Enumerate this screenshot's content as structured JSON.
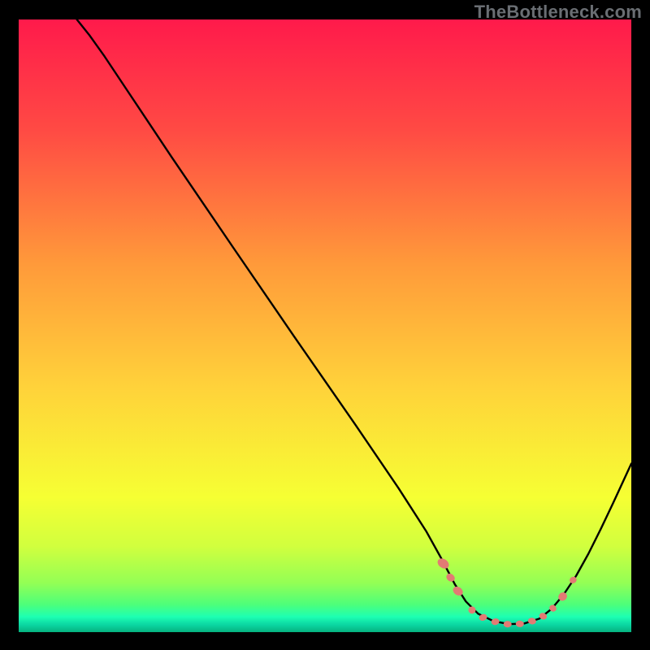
{
  "watermark": "TheBottleneck.com",
  "chart_data": {
    "type": "line",
    "title": "",
    "xlabel": "",
    "ylabel": "",
    "xlim": [
      0,
      100
    ],
    "ylim": [
      0,
      100
    ],
    "grid": false,
    "legend": false,
    "annotations": [],
    "background_gradient_stops": [
      {
        "offset": 0.0,
        "color": "#ff1a4b"
      },
      {
        "offset": 0.18,
        "color": "#ff4a44"
      },
      {
        "offset": 0.4,
        "color": "#ff9a3a"
      },
      {
        "offset": 0.6,
        "color": "#ffd23a"
      },
      {
        "offset": 0.78,
        "color": "#f6ff33"
      },
      {
        "offset": 0.86,
        "color": "#d1ff3e"
      },
      {
        "offset": 0.92,
        "color": "#93ff55"
      },
      {
        "offset": 0.955,
        "color": "#4dff7a"
      },
      {
        "offset": 0.975,
        "color": "#1dffb2"
      },
      {
        "offset": 0.988,
        "color": "#0bd6a2"
      },
      {
        "offset": 1.0,
        "color": "#06b27f"
      }
    ],
    "curve": [
      {
        "x": 9.5,
        "y": 100.0
      },
      {
        "x": 11.5,
        "y": 97.5
      },
      {
        "x": 14.0,
        "y": 94.0
      },
      {
        "x": 18.0,
        "y": 88.0
      },
      {
        "x": 25.0,
        "y": 77.5
      },
      {
        "x": 35.0,
        "y": 62.8
      },
      {
        "x": 45.0,
        "y": 48.2
      },
      {
        "x": 55.0,
        "y": 33.8
      },
      {
        "x": 62.0,
        "y": 23.5
      },
      {
        "x": 66.5,
        "y": 16.5
      },
      {
        "x": 69.0,
        "y": 12.0
      },
      {
        "x": 71.2,
        "y": 7.8
      },
      {
        "x": 73.0,
        "y": 5.0
      },
      {
        "x": 75.0,
        "y": 3.0
      },
      {
        "x": 77.5,
        "y": 1.8
      },
      {
        "x": 80.0,
        "y": 1.3
      },
      {
        "x": 82.5,
        "y": 1.4
      },
      {
        "x": 85.0,
        "y": 2.2
      },
      {
        "x": 87.0,
        "y": 3.8
      },
      {
        "x": 89.0,
        "y": 6.2
      },
      {
        "x": 91.0,
        "y": 9.2
      },
      {
        "x": 93.0,
        "y": 12.8
      },
      {
        "x": 95.0,
        "y": 16.8
      },
      {
        "x": 97.0,
        "y": 21.0
      },
      {
        "x": 100.0,
        "y": 27.5
      }
    ],
    "markers": [
      {
        "x": 69.3,
        "y": 11.2,
        "rx": 5.5,
        "ry": 7.5,
        "angle": -55
      },
      {
        "x": 70.5,
        "y": 8.9,
        "rx": 4.5,
        "ry": 5.5,
        "angle": -55
      },
      {
        "x": 71.7,
        "y": 6.7,
        "rx": 5.0,
        "ry": 6.5,
        "angle": -55
      },
      {
        "x": 74.0,
        "y": 3.6,
        "rx": 4.5,
        "ry": 4.5,
        "angle": 0
      },
      {
        "x": 75.8,
        "y": 2.4,
        "rx": 5.0,
        "ry": 4.0,
        "angle": -20
      },
      {
        "x": 77.8,
        "y": 1.7,
        "rx": 5.0,
        "ry": 4.0,
        "angle": -10
      },
      {
        "x": 79.8,
        "y": 1.3,
        "rx": 5.0,
        "ry": 4.0,
        "angle": 0
      },
      {
        "x": 81.8,
        "y": 1.35,
        "rx": 5.0,
        "ry": 4.0,
        "angle": 5
      },
      {
        "x": 83.8,
        "y": 1.8,
        "rx": 5.0,
        "ry": 4.0,
        "angle": 12
      },
      {
        "x": 85.6,
        "y": 2.6,
        "rx": 4.8,
        "ry": 4.0,
        "angle": 22
      },
      {
        "x": 87.2,
        "y": 3.9,
        "rx": 4.5,
        "ry": 4.0,
        "angle": 35
      },
      {
        "x": 88.8,
        "y": 5.8,
        "rx": 5.0,
        "ry": 5.5,
        "angle": 55
      },
      {
        "x": 90.5,
        "y": 8.5,
        "rx": 4.0,
        "ry": 4.5,
        "angle": 55
      }
    ],
    "curve_color": "#000000",
    "curve_width": 2.4,
    "marker_color": "#e27b74"
  }
}
